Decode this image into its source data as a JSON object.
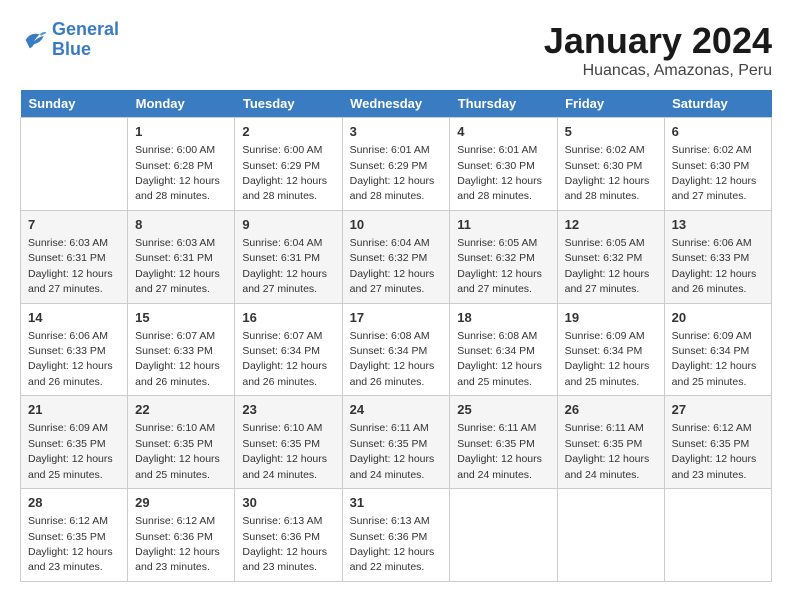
{
  "header": {
    "logo_line1": "General",
    "logo_line2": "Blue",
    "title": "January 2024",
    "subtitle": "Huancas, Amazonas, Peru"
  },
  "calendar": {
    "days_of_week": [
      "Sunday",
      "Monday",
      "Tuesday",
      "Wednesday",
      "Thursday",
      "Friday",
      "Saturday"
    ],
    "weeks": [
      [
        {
          "day": "",
          "empty": true
        },
        {
          "day": "1",
          "sunrise": "6:00 AM",
          "sunset": "6:28 PM",
          "daylight": "12 hours and 28 minutes."
        },
        {
          "day": "2",
          "sunrise": "6:00 AM",
          "sunset": "6:29 PM",
          "daylight": "12 hours and 28 minutes."
        },
        {
          "day": "3",
          "sunrise": "6:01 AM",
          "sunset": "6:29 PM",
          "daylight": "12 hours and 28 minutes."
        },
        {
          "day": "4",
          "sunrise": "6:01 AM",
          "sunset": "6:30 PM",
          "daylight": "12 hours and 28 minutes."
        },
        {
          "day": "5",
          "sunrise": "6:02 AM",
          "sunset": "6:30 PM",
          "daylight": "12 hours and 28 minutes."
        },
        {
          "day": "6",
          "sunrise": "6:02 AM",
          "sunset": "6:30 PM",
          "daylight": "12 hours and 27 minutes."
        }
      ],
      [
        {
          "day": "7",
          "sunrise": "6:03 AM",
          "sunset": "6:31 PM",
          "daylight": "12 hours and 27 minutes."
        },
        {
          "day": "8",
          "sunrise": "6:03 AM",
          "sunset": "6:31 PM",
          "daylight": "12 hours and 27 minutes."
        },
        {
          "day": "9",
          "sunrise": "6:04 AM",
          "sunset": "6:31 PM",
          "daylight": "12 hours and 27 minutes."
        },
        {
          "day": "10",
          "sunrise": "6:04 AM",
          "sunset": "6:32 PM",
          "daylight": "12 hours and 27 minutes."
        },
        {
          "day": "11",
          "sunrise": "6:05 AM",
          "sunset": "6:32 PM",
          "daylight": "12 hours and 27 minutes."
        },
        {
          "day": "12",
          "sunrise": "6:05 AM",
          "sunset": "6:32 PM",
          "daylight": "12 hours and 27 minutes."
        },
        {
          "day": "13",
          "sunrise": "6:06 AM",
          "sunset": "6:33 PM",
          "daylight": "12 hours and 26 minutes."
        }
      ],
      [
        {
          "day": "14",
          "sunrise": "6:06 AM",
          "sunset": "6:33 PM",
          "daylight": "12 hours and 26 minutes."
        },
        {
          "day": "15",
          "sunrise": "6:07 AM",
          "sunset": "6:33 PM",
          "daylight": "12 hours and 26 minutes."
        },
        {
          "day": "16",
          "sunrise": "6:07 AM",
          "sunset": "6:34 PM",
          "daylight": "12 hours and 26 minutes."
        },
        {
          "day": "17",
          "sunrise": "6:08 AM",
          "sunset": "6:34 PM",
          "daylight": "12 hours and 26 minutes."
        },
        {
          "day": "18",
          "sunrise": "6:08 AM",
          "sunset": "6:34 PM",
          "daylight": "12 hours and 25 minutes."
        },
        {
          "day": "19",
          "sunrise": "6:09 AM",
          "sunset": "6:34 PM",
          "daylight": "12 hours and 25 minutes."
        },
        {
          "day": "20",
          "sunrise": "6:09 AM",
          "sunset": "6:34 PM",
          "daylight": "12 hours and 25 minutes."
        }
      ],
      [
        {
          "day": "21",
          "sunrise": "6:09 AM",
          "sunset": "6:35 PM",
          "daylight": "12 hours and 25 minutes."
        },
        {
          "day": "22",
          "sunrise": "6:10 AM",
          "sunset": "6:35 PM",
          "daylight": "12 hours and 25 minutes."
        },
        {
          "day": "23",
          "sunrise": "6:10 AM",
          "sunset": "6:35 PM",
          "daylight": "12 hours and 24 minutes."
        },
        {
          "day": "24",
          "sunrise": "6:11 AM",
          "sunset": "6:35 PM",
          "daylight": "12 hours and 24 minutes."
        },
        {
          "day": "25",
          "sunrise": "6:11 AM",
          "sunset": "6:35 PM",
          "daylight": "12 hours and 24 minutes."
        },
        {
          "day": "26",
          "sunrise": "6:11 AM",
          "sunset": "6:35 PM",
          "daylight": "12 hours and 24 minutes."
        },
        {
          "day": "27",
          "sunrise": "6:12 AM",
          "sunset": "6:35 PM",
          "daylight": "12 hours and 23 minutes."
        }
      ],
      [
        {
          "day": "28",
          "sunrise": "6:12 AM",
          "sunset": "6:35 PM",
          "daylight": "12 hours and 23 minutes."
        },
        {
          "day": "29",
          "sunrise": "6:12 AM",
          "sunset": "6:36 PM",
          "daylight": "12 hours and 23 minutes."
        },
        {
          "day": "30",
          "sunrise": "6:13 AM",
          "sunset": "6:36 PM",
          "daylight": "12 hours and 23 minutes."
        },
        {
          "day": "31",
          "sunrise": "6:13 AM",
          "sunset": "6:36 PM",
          "daylight": "12 hours and 22 minutes."
        },
        {
          "day": "",
          "empty": true
        },
        {
          "day": "",
          "empty": true
        },
        {
          "day": "",
          "empty": true
        }
      ]
    ]
  }
}
